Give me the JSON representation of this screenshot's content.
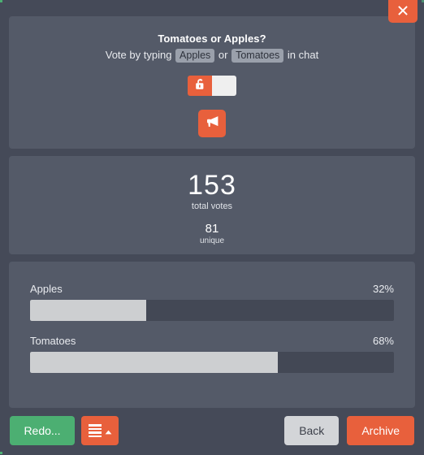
{
  "close_button": {
    "icon": "close-icon",
    "label": "×"
  },
  "question": {
    "title": "Tomatoes or Apples?",
    "instruction_prefix": "Vote by typing",
    "option_a_chip": "Apples",
    "conjunction": "or",
    "option_b_chip": "Tomatoes",
    "instruction_suffix": "in chat",
    "lock_toggle": {
      "icon": "unlock-icon",
      "state": "unlocked"
    },
    "announce_button": {
      "icon": "megaphone-icon"
    }
  },
  "counts": {
    "total_votes": "153",
    "total_votes_label": "total votes",
    "unique_votes": "81",
    "unique_votes_label": "unique"
  },
  "results": [
    {
      "name": "Apples",
      "percent_label": "32%",
      "percent": 32
    },
    {
      "name": "Tomatoes",
      "percent_label": "68%",
      "percent": 68
    }
  ],
  "footer": {
    "redo_label": "Redo...",
    "menu_icon": "list-menu-icon",
    "menu_caret_icon": "caret-up-icon",
    "back_label": "Back",
    "archive_label": "Archive"
  },
  "colors": {
    "page_background": "#454a58",
    "card_background": "#545a68",
    "accent_orange": "#e8603c",
    "accent_green": "#4caf72",
    "bar_fill": "#cdcfd1",
    "bar_track": "#434855",
    "chip_background": "#9aa0ab",
    "button_gray": "#d3d5d8"
  },
  "chart_data": {
    "type": "bar",
    "title": "Tomatoes or Apples?",
    "categories": [
      "Apples",
      "Tomatoes"
    ],
    "values": [
      32,
      68
    ],
    "value_labels": [
      "32%",
      "68%"
    ],
    "xlabel": "",
    "ylabel": "",
    "ylim": [
      0,
      100
    ],
    "orientation": "horizontal",
    "grid": false,
    "legend": "none",
    "total_votes": 153,
    "unique_votes": 81
  }
}
